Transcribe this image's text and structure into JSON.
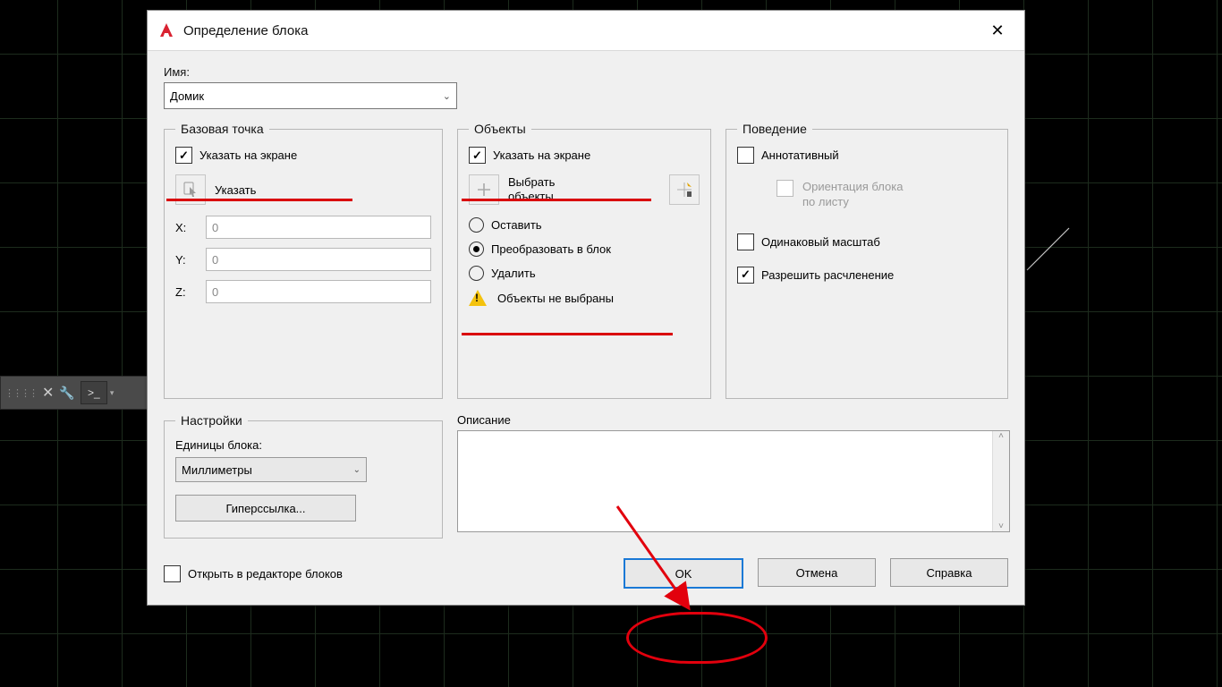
{
  "title": "Определение блока",
  "name_label": "Имя:",
  "name_value": "Домик",
  "base_point": {
    "legend": "Базовая точка",
    "specify_on_screen": "Указать на экране",
    "pick_button": "Указать",
    "x_label": "X:",
    "y_label": "Y:",
    "z_label": "Z:",
    "x": "0",
    "y": "0",
    "z": "0"
  },
  "objects": {
    "legend": "Объекты",
    "specify_on_screen": "Указать на экране",
    "select_objects_l1": "Выбрать",
    "select_objects_l2": "объекты",
    "retain": "Оставить",
    "convert": "Преобразовать в блок",
    "delete": "Удалить",
    "no_objects": "Объекты не выбраны"
  },
  "behavior": {
    "legend": "Поведение",
    "annotative": "Аннотативный",
    "orientation_l1": "Ориентация блока",
    "orientation_l2": "по листу",
    "uniform_scale": "Одинаковый масштаб",
    "allow_explode": "Разрешить расчленение"
  },
  "settings": {
    "legend": "Настройки",
    "block_units_label": "Единицы блока:",
    "block_units_value": "Миллиметры",
    "hyperlink": "Гиперссылка..."
  },
  "description_label": "Описание",
  "open_in_editor": "Открыть в редакторе блоков",
  "buttons": {
    "ok": "OK",
    "cancel": "Отмена",
    "help": "Справка"
  }
}
